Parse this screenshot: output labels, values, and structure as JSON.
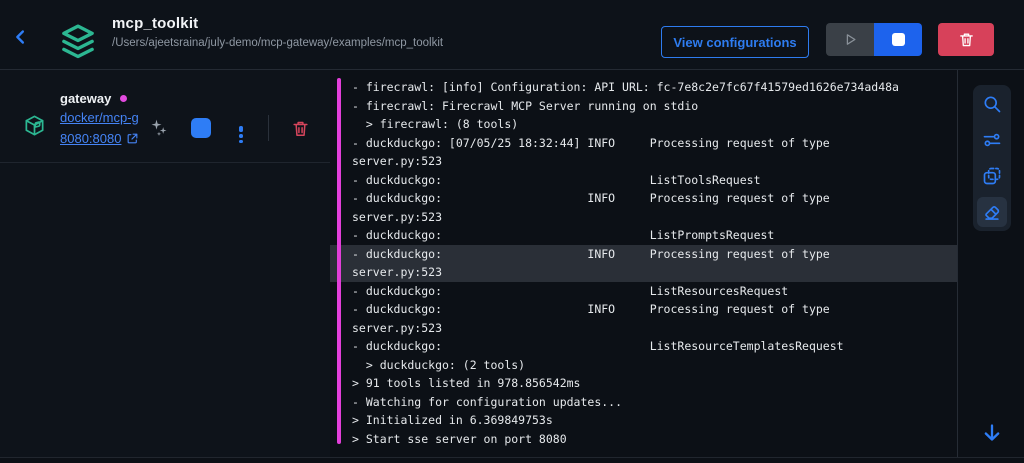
{
  "colors": {
    "accent_blue": "#2e7df6",
    "docker_blue": "#1d63ed",
    "teal": "#2cb792",
    "magenta": "#e23fd9",
    "red": "#d7415a",
    "highlight_row": "#2a2f37"
  },
  "header": {
    "title": "mcp_toolkit",
    "path": "/Users/ajeetsraina/july-demo/mcp-gateway/examples/mcp_toolkit",
    "view_configurations_label": "View configurations"
  },
  "sidebar": {
    "service": {
      "name": "gateway",
      "image_link": "docker/mcp-g",
      "port_link": "8080:8080"
    }
  },
  "right_toolbar": {
    "icons": [
      "search-icon",
      "filter-sliders-icon",
      "copy-dashed-icon",
      "eraser-icon"
    ]
  },
  "logs": {
    "lines": [
      {
        "text": "- firecrawl: [info] Configuration: API URL: fc-7e8c2e7fc67f41579ed1626e734ad48a"
      },
      {
        "text": "- firecrawl: Firecrawl MCP Server running on stdio"
      },
      {
        "text": "  > firecrawl: (8 tools)"
      },
      {
        "text": "- duckduckgo: [07/05/25 18:32:44] INFO     Processing request of type"
      },
      {
        "text": "server.py:523"
      },
      {
        "text": "- duckduckgo:                              ListToolsRequest"
      },
      {
        "text": "- duckduckgo:                     INFO     Processing request of type"
      },
      {
        "text": "server.py:523"
      },
      {
        "text": "- duckduckgo:                              ListPromptsRequest"
      },
      {
        "text": "- duckduckgo:                     INFO     Processing request of type",
        "class": "hl"
      },
      {
        "text": "server.py:523",
        "class": "hl"
      },
      {
        "text": "- duckduckgo:                              ListResourcesRequest"
      },
      {
        "text": "- duckduckgo:                     INFO     Processing request of type"
      },
      {
        "text": "server.py:523"
      },
      {
        "text": "- duckduckgo:                              ListResourceTemplatesRequest"
      },
      {
        "text": "  > duckduckgo: (2 tools)"
      },
      {
        "text": "> 91 tools listed in 978.856542ms"
      },
      {
        "text": "- Watching for configuration updates..."
      },
      {
        "text": "> Initialized in 6.369849753s"
      },
      {
        "text": "> Start sse server on port 8080"
      }
    ]
  }
}
